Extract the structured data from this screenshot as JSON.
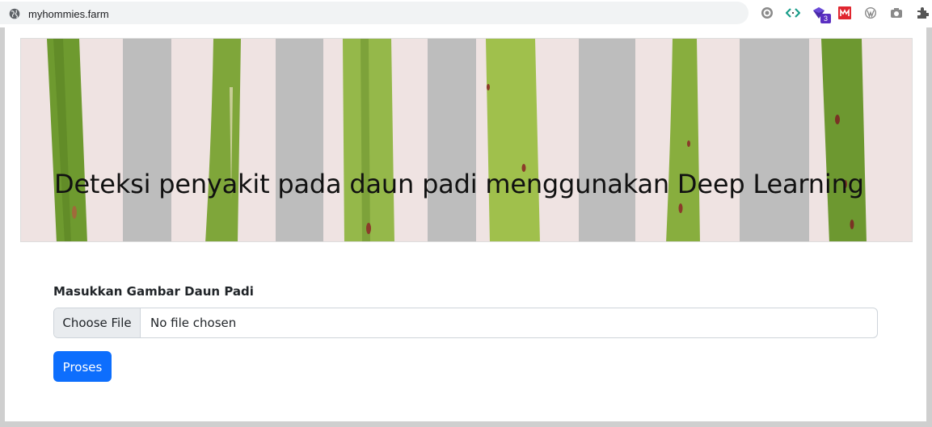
{
  "browser": {
    "url": "myhommies.farm",
    "extensions": [
      {
        "icon": "gear-extension-icon"
      },
      {
        "icon": "code-brackets-icon"
      },
      {
        "icon": "purple-cube-icon",
        "badge": "3"
      },
      {
        "icon": "red-m-icon"
      },
      {
        "icon": "wordpress-icon"
      },
      {
        "icon": "camera-icon"
      },
      {
        "icon": "puzzle-icon"
      }
    ]
  },
  "hero": {
    "title": "Deteksi penyakit pada daun padi menggunakan Deep Learning"
  },
  "form": {
    "label": "Masukkan Gambar Daun Padi",
    "file_button": "Choose File",
    "file_status": "No file chosen",
    "submit_label": "Proses"
  },
  "colors": {
    "primary": "#0d6efd",
    "leaf_green": "#8aab3a",
    "stripe_gray": "#bdbdbd",
    "hero_bg": "#efe3e2"
  }
}
